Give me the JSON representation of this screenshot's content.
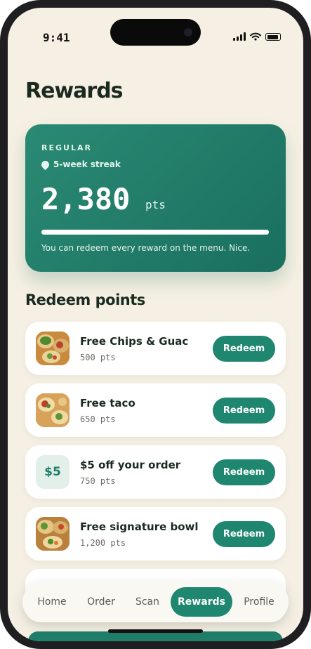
{
  "status_bar": {
    "time": "9:41"
  },
  "page": {
    "title": "Rewards",
    "section_title": "Redeem points"
  },
  "rewards_card": {
    "tier": "REGULAR",
    "streak": "5-week streak",
    "points": "2,380",
    "points_unit": "pts",
    "progress_fraction": 1.0,
    "message": "You can redeem every reward on the menu. Nice."
  },
  "rewards": [
    {
      "name": "Free Chips & Guac",
      "points": "500 pts",
      "button": "Redeem",
      "thumb": "food-photo"
    },
    {
      "name": "Free taco",
      "points": "650 pts",
      "button": "Redeem",
      "thumb": "food-photo"
    },
    {
      "name": "$5 off your order",
      "points": "750 pts",
      "button": "Redeem",
      "thumb": "$5"
    },
    {
      "name": "Free signature bowl",
      "points": "1,200 pts",
      "button": "Redeem",
      "thumb": "food-photo"
    }
  ],
  "tabs": [
    {
      "label": "Home",
      "active": false
    },
    {
      "label": "Order",
      "active": false
    },
    {
      "label": "Scan",
      "active": false
    },
    {
      "label": "Rewards",
      "active": true
    },
    {
      "label": "Profile",
      "active": false
    }
  ],
  "colors": {
    "accent": "#1f8670",
    "background": "#f5f0e3",
    "card": "#1a6f5e"
  }
}
